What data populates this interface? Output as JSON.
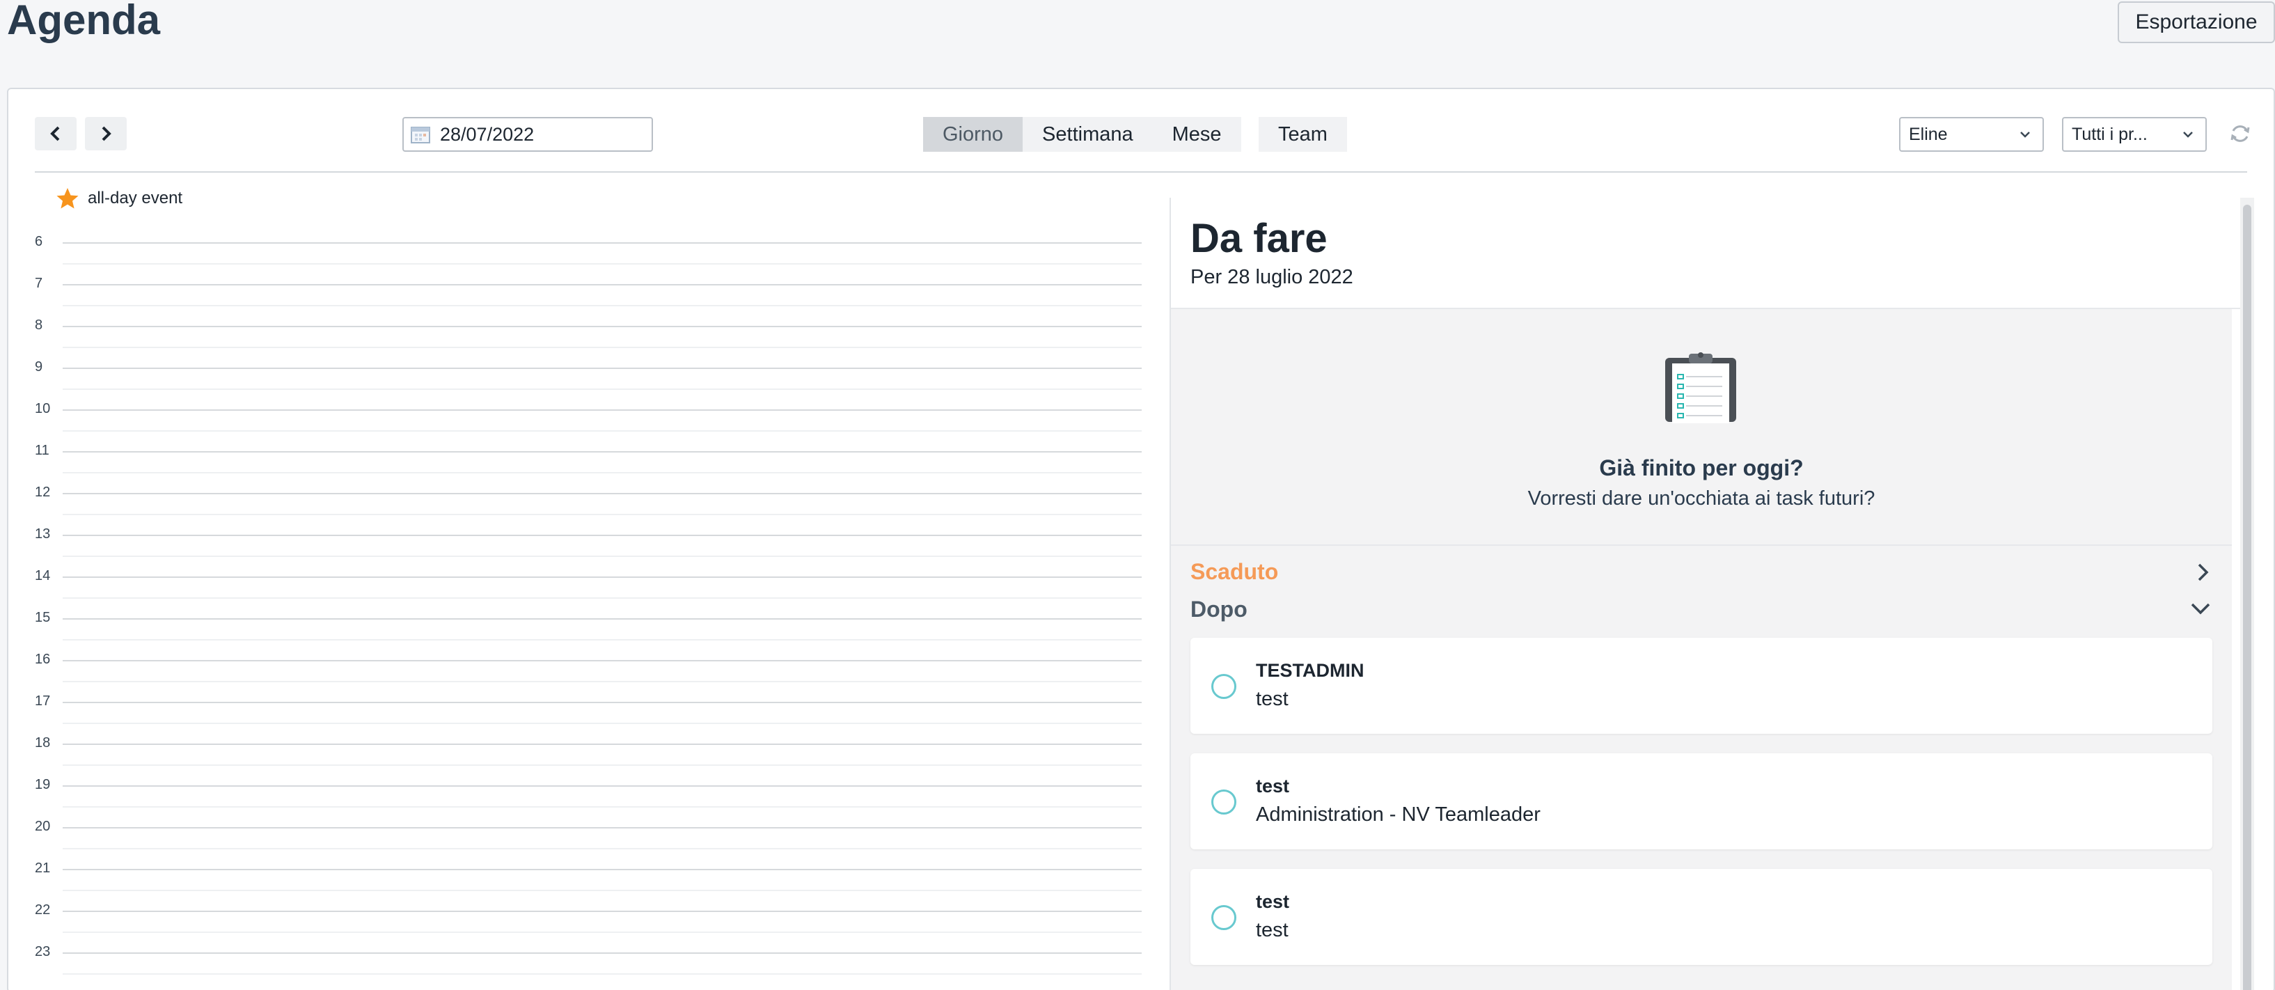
{
  "page": {
    "title": "Agenda",
    "export_label": "Esportazione"
  },
  "toolbar": {
    "prev_icon": "chevron-left-icon",
    "next_icon": "chevron-right-icon",
    "date_value": "28/07/2022",
    "views": [
      "Giorno",
      "Settimana",
      "Mese"
    ],
    "active_view": "Giorno",
    "team_label": "Team",
    "user_select": "Eline",
    "type_select": "Tutti i pr...",
    "refresh_icon": "refresh-icon"
  },
  "calendar": {
    "allday_label": "all-day event",
    "hours": [
      "6",
      "7",
      "8",
      "9",
      "10",
      "11",
      "12",
      "13",
      "14",
      "15",
      "16",
      "17",
      "18",
      "19",
      "20",
      "21",
      "22",
      "23"
    ]
  },
  "todo": {
    "title": "Da fare",
    "subtitle": "Per 28 luglio 2022",
    "empty_title": "Già finito per oggi?",
    "empty_subtitle": "Vorresti dare un'occhiata ai task futuri?",
    "overdue_label": "Scaduto",
    "later_label": "Dopo",
    "tasks": [
      {
        "title": "TESTADMIN",
        "subtitle": "test"
      },
      {
        "title": "test",
        "subtitle": "Administration - NV Teamleader"
      },
      {
        "title": "test",
        "subtitle": "test"
      }
    ]
  },
  "colors": {
    "overdue": "#f59a57",
    "check_ring": "#68c9cf",
    "star": "#f7941d",
    "heading": "#2a3b4d"
  }
}
